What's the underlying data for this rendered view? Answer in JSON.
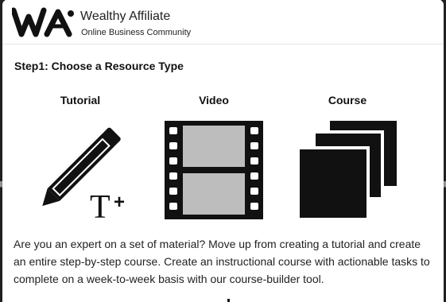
{
  "header": {
    "logo_text": "WA",
    "title": "Wealthy Affiliate",
    "subtitle": "Online Business Community"
  },
  "step": {
    "heading": "Step1: Choose a Resource Type"
  },
  "resource_types": [
    {
      "label": "Tutorial",
      "icon": "pencil-text-icon"
    },
    {
      "label": "Video",
      "icon": "film-strip-icon"
    },
    {
      "label": "Course",
      "icon": "stacked-pages-icon"
    }
  ],
  "description": "Are you an expert on a set of material? Move up from creating a tutorial and create an entire step-by-step course. Create an instructional course with actionable tasks to complete on a week-to-week basis with our course-builder tool.",
  "colors": {
    "icon": "#111111",
    "film_frame": "#bdbdbd",
    "text": "#222222"
  }
}
